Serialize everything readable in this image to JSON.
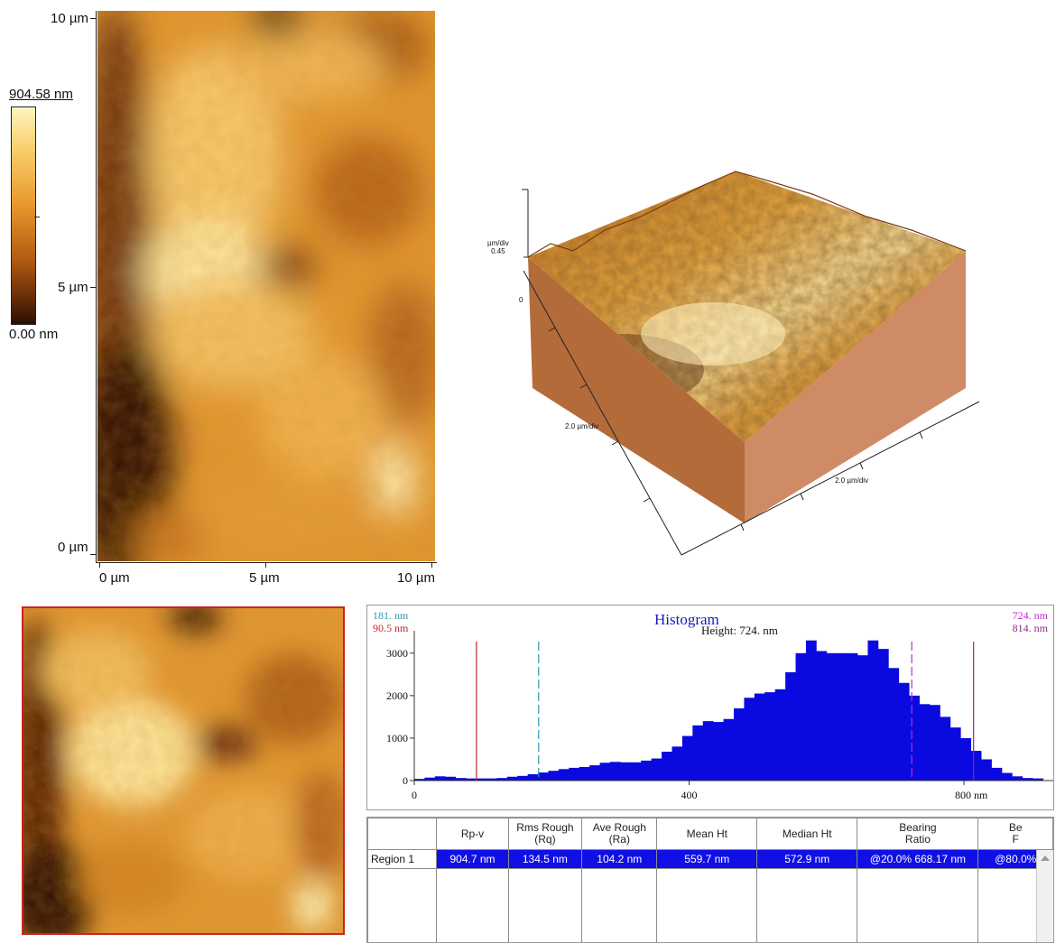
{
  "main_image": {
    "y_axis_labels": [
      "10 µm",
      "5 µm",
      "0 µm"
    ],
    "x_axis_labels": [
      "0 µm",
      "5 µm",
      "10 µm"
    ],
    "colorbar_max": "904.58 nm",
    "colorbar_min": "0.00 nm"
  },
  "surface3d": {
    "z_axis_unit": "µm/div",
    "z_axis_max": "0.45",
    "z_axis_zero": "0",
    "x_axis_label": "2.0 µm/div",
    "y_axis_label": "2.0 µm/div"
  },
  "histogram": {
    "title": "Histogram",
    "readout": "Height: 724. nm",
    "cursor_left_upper": "181. nm",
    "cursor_left_lower": "90.5 nm",
    "cursor_right_upper": "724. nm",
    "cursor_right_lower": "814. nm",
    "cursor_colors": {
      "left_lower": "#c0282b",
      "left_upper": "#2a9aa8",
      "right_upper": "#c02ad0",
      "right_lower": "#8a2a8a"
    },
    "bar_color": "#0a0ae0",
    "chart_data": {
      "type": "bar",
      "xlabel": "nm",
      "x_tick_labels": [
        "0",
        "400",
        "800 nm"
      ],
      "y_tick_labels": [
        "0",
        "1000",
        "2000",
        "3000"
      ],
      "xlim": [
        0,
        930
      ],
      "ylim": [
        0,
        3400
      ],
      "bin_width": 15,
      "bin_start": 0,
      "values": [
        40,
        70,
        100,
        90,
        60,
        50,
        50,
        50,
        60,
        90,
        110,
        150,
        190,
        230,
        270,
        300,
        320,
        360,
        420,
        440,
        430,
        430,
        470,
        520,
        680,
        800,
        1050,
        1300,
        1400,
        1380,
        1450,
        1700,
        1950,
        2050,
        2080,
        2150,
        2550,
        3000,
        3300,
        3050,
        3000,
        3000,
        3000,
        2950,
        3300,
        3100,
        2650,
        2300,
        2000,
        1800,
        1780,
        1500,
        1250,
        1000,
        700,
        500,
        300,
        180,
        100,
        60,
        50
      ]
    }
  },
  "table": {
    "headers": [
      "",
      "Rp-v",
      "Rms Rough (Rq)",
      "Ave Rough (Ra)",
      "Mean Ht",
      "Median Ht",
      "Bearing Ratio",
      "Be F"
    ],
    "header_lines": [
      [
        "",
        ""
      ],
      [
        "Rp-v",
        ""
      ],
      [
        "Rms Rough",
        "(Rq)"
      ],
      [
        "Ave Rough",
        "(Ra)"
      ],
      [
        "Mean Ht",
        ""
      ],
      [
        "Median Ht",
        ""
      ],
      [
        "Bearing",
        "Ratio"
      ],
      [
        "Be",
        "F"
      ]
    ],
    "rows": [
      {
        "region": "Region 1",
        "values": [
          "904.7 nm",
          "134.5 nm",
          "104.2 nm",
          "559.7 nm",
          "572.9 nm",
          "@20.0% 668.17 nm",
          "@80.0%"
        ]
      }
    ],
    "selection_color": "#1010e6"
  }
}
